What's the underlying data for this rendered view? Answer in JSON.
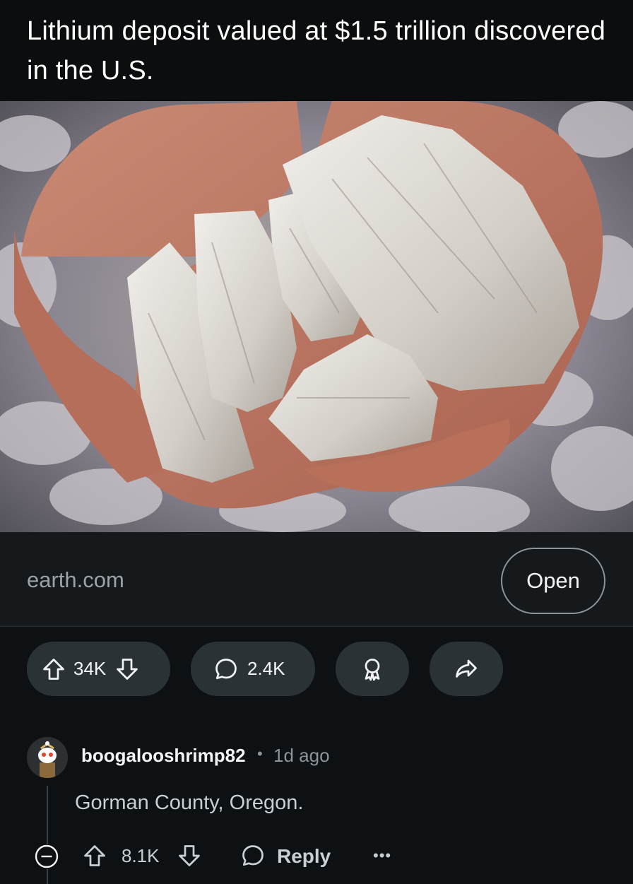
{
  "post": {
    "title": "Lithium deposit valued at $1.5 trillion discovered in the U.S.",
    "image_icon": "lithium-ore-photo",
    "link": {
      "domain": "earth.com",
      "open_label": "Open"
    },
    "votes": "34K",
    "comments_count": "2.4K"
  },
  "comment": {
    "author": "boogalooshrimp82",
    "separator": "•",
    "age": "1d ago",
    "body": "Gorman County, Oregon.",
    "votes": "8.1K",
    "reply_label": "Reply",
    "more_label": "•••"
  },
  "colors": {
    "background": "#0e1113",
    "pill": "#2b3236",
    "text": "#f2f4f5",
    "muted": "#8b9499"
  }
}
